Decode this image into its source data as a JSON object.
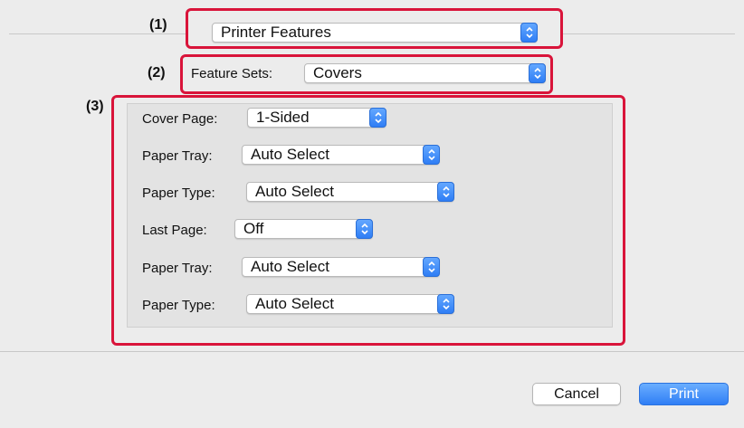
{
  "callouts": {
    "one": "(1)",
    "two": "(2)",
    "three": "(3)"
  },
  "printer_features": {
    "value": "Printer Features"
  },
  "feature_sets": {
    "label": "Feature Sets:",
    "value": "Covers"
  },
  "fields": [
    {
      "label": "Cover Page:",
      "value": "1-Sided"
    },
    {
      "label": "Paper Tray:",
      "value": "Auto Select"
    },
    {
      "label": "Paper Type:",
      "value": "Auto Select"
    },
    {
      "label": "Last Page:",
      "value": "Off"
    },
    {
      "label": "Paper Tray:",
      "value": "Auto Select"
    },
    {
      "label": "Paper Type:",
      "value": "Auto Select"
    }
  ],
  "buttons": {
    "cancel": "Cancel",
    "print": "Print"
  },
  "colors": {
    "highlight": "#d9143a",
    "accent": "#2f7ef5"
  },
  "icons": {
    "stepper": "up-down-chevron-icon"
  }
}
